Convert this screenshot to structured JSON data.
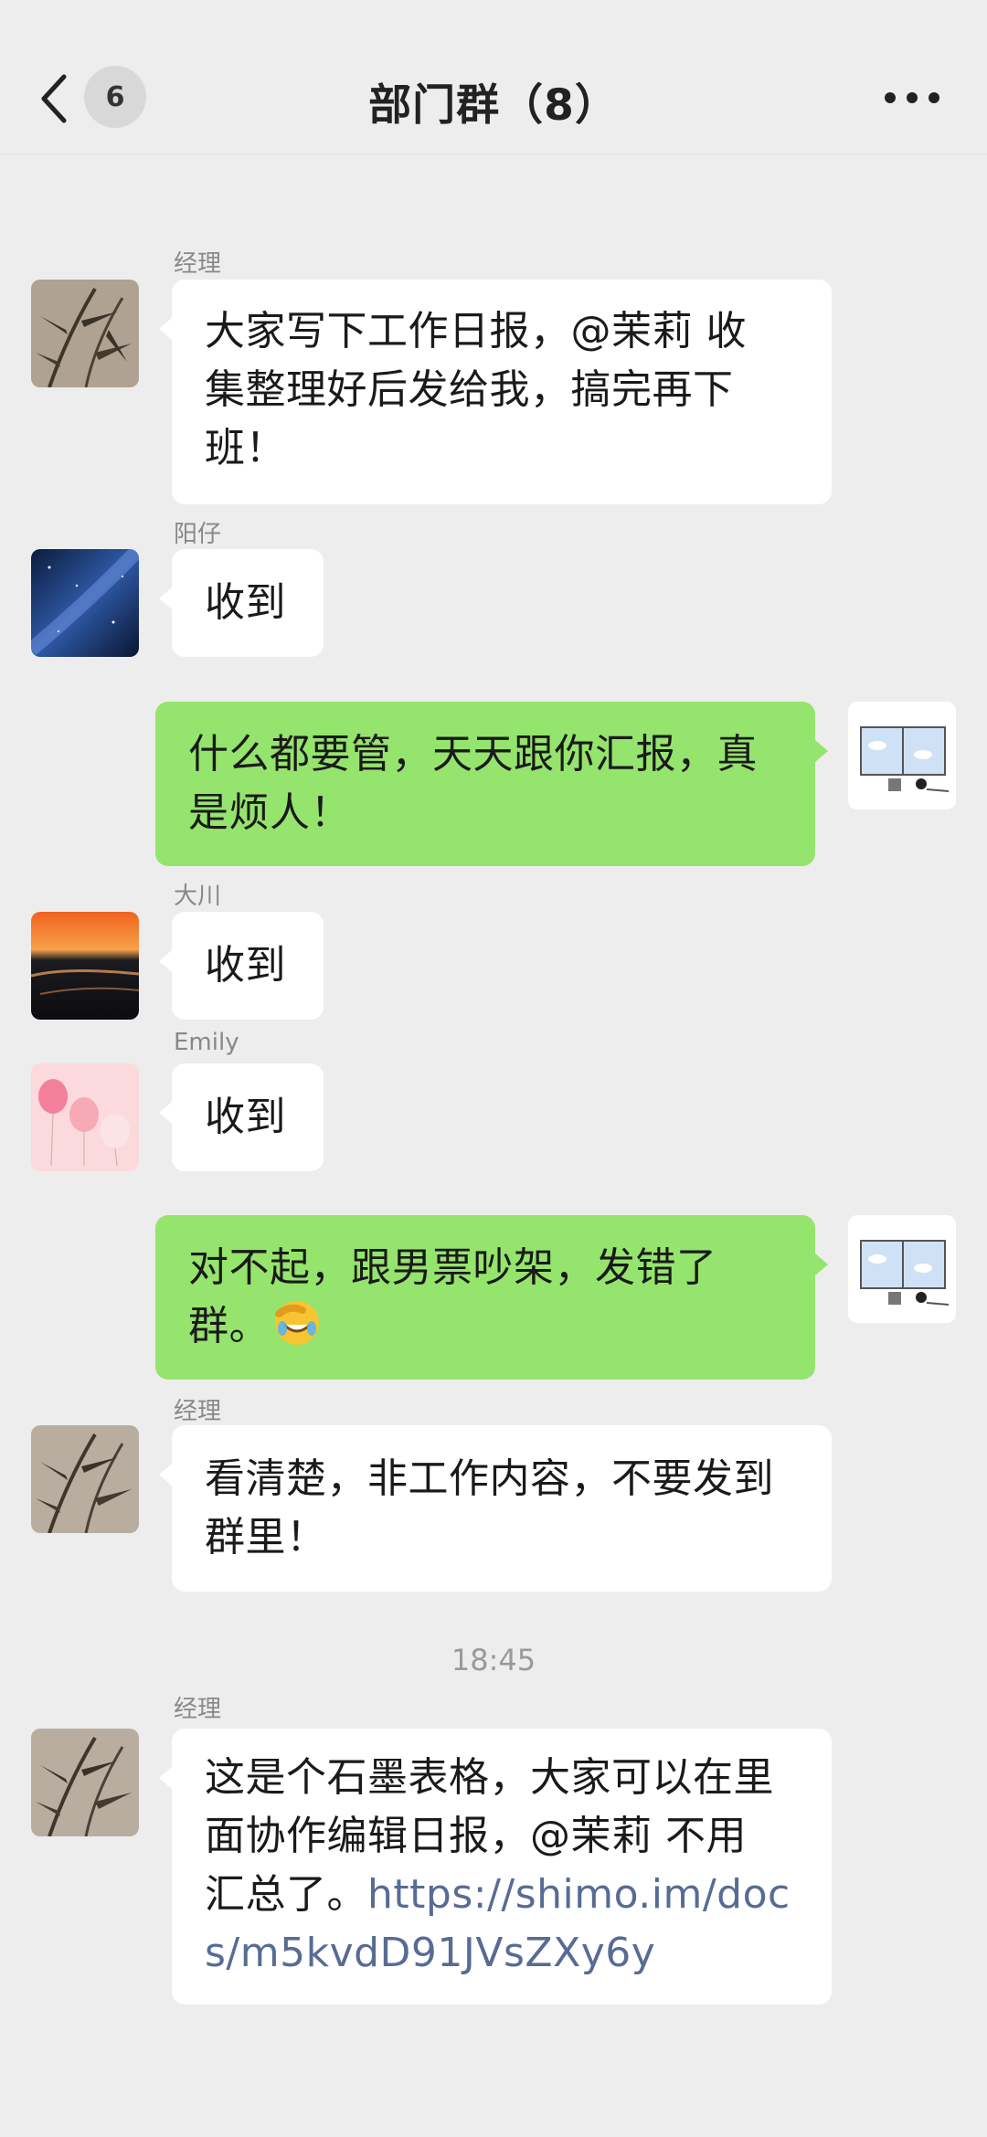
{
  "header": {
    "back_count": "6",
    "title": "部门群（8）"
  },
  "messages": [
    {
      "sender": "经理",
      "text": "大家写下工作日报，@茉莉 收集整理好后发给我，搞完再下班！",
      "lines": [
        "大家写下工作日报，@茉莉 收",
        "集整理好后发给我，搞完再下",
        "班！"
      ],
      "side": "left",
      "avatar": "bamboo-avatar"
    },
    {
      "sender": "阳仔",
      "text": "收到",
      "side": "left",
      "avatar": "galaxy-avatar"
    },
    {
      "sender": "",
      "lines": [
        "什么都要管，天天跟你汇报，真",
        "是烦人！"
      ],
      "side": "right",
      "avatar": "window-sketch-avatar"
    },
    {
      "sender": "大川",
      "text": "收到",
      "side": "left",
      "avatar": "sunset-avatar"
    },
    {
      "sender": "Emily",
      "text": "收到",
      "side": "left",
      "avatar": "balloons-avatar"
    },
    {
      "sender": "",
      "lines": [
        "对不起，跟男票吵架，发错了",
        "群。"
      ],
      "emoji": "facepalm-emoji",
      "side": "right",
      "avatar": "window-sketch-avatar"
    },
    {
      "sender": "经理",
      "lines": [
        "看清楚，非工作内容，不要发到",
        "群里！"
      ],
      "side": "left",
      "avatar": "bamboo-avatar"
    },
    {
      "sender": "经理",
      "lines": [
        "这是个石墨表格，大家可以在里",
        "面协作编辑日报，@茉莉 不用",
        "汇总了。"
      ],
      "link_part1": "https://shimo.im/doc",
      "link_part2": "s/m5kvdD91JVsZXy6y",
      "side": "left",
      "avatar": "bamboo-avatar"
    }
  ],
  "timestamp": "18:45",
  "colors": {
    "background": "#ededed",
    "green_bubble": "#95e46d",
    "white_bubble": "#ffffff",
    "link": "#576b95"
  }
}
